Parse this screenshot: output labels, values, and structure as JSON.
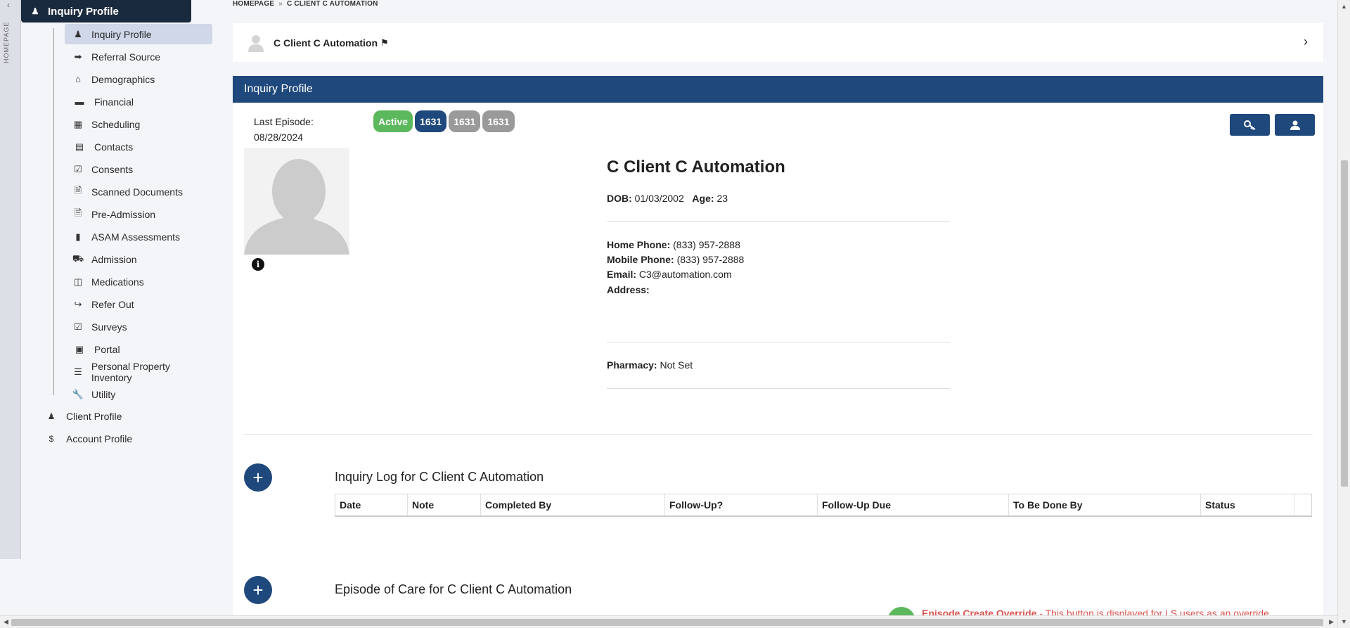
{
  "rail": {
    "vertical_label": "HOMEPAGE"
  },
  "sidebar": {
    "active_label": "Inquiry Profile",
    "subitems": [
      {
        "label": "Inquiry Profile",
        "icon": "user-icon"
      },
      {
        "label": "Referral Source",
        "icon": "sign-in-icon"
      },
      {
        "label": "Demographics",
        "icon": "home-icon"
      },
      {
        "label": "Financial",
        "icon": "credit-card-icon"
      },
      {
        "label": "Scheduling",
        "icon": "calendar-icon"
      },
      {
        "label": "Contacts",
        "icon": "address-card-icon"
      },
      {
        "label": "Consents",
        "icon": "check-square-icon"
      },
      {
        "label": "Scanned Documents",
        "icon": "file-icon"
      },
      {
        "label": "Pre-Admission",
        "icon": "file-icon"
      },
      {
        "label": "ASAM Assessments",
        "icon": "book-icon"
      },
      {
        "label": "Admission",
        "icon": "car-icon"
      },
      {
        "label": "Medications",
        "icon": "medkit-icon"
      },
      {
        "label": "Refer Out",
        "icon": "sign-out-icon"
      },
      {
        "label": "Surveys",
        "icon": "check-square-icon"
      },
      {
        "label": "Portal",
        "icon": "laptop-icon"
      },
      {
        "label": "Personal Property Inventory",
        "icon": "list-icon"
      },
      {
        "label": "Utility",
        "icon": "wrench-icon"
      }
    ],
    "top_items": [
      {
        "label": "Client Profile",
        "icon": "user-icon"
      },
      {
        "label": "Account Profile",
        "icon": "dollar-icon"
      }
    ]
  },
  "breadcrumb": {
    "home": "HOMEPAGE",
    "separator": "»",
    "current": "C CLIENT C AUTOMATION"
  },
  "client_bar": {
    "name": "C Client C Automation"
  },
  "panel": {
    "title": "Inquiry Profile",
    "last_episode_label": "Last Episode:",
    "last_episode_date": "08/28/2024",
    "badges": [
      "Active",
      "1631",
      "1631",
      "1631"
    ],
    "client_name": "C Client C Automation",
    "dob_label": "DOB:",
    "dob": "01/03/2002",
    "age_label": "Age:",
    "age": "23",
    "home_phone_label": "Home Phone:",
    "home_phone": "(833) 957-2888",
    "mobile_phone_label": "Mobile Phone:",
    "mobile_phone": "(833) 957-2888",
    "email_label": "Email:",
    "email": "C3@automation.com",
    "address_label": "Address:",
    "pharmacy_label": "Pharmacy:",
    "pharmacy": "Not Set"
  },
  "inquiry_log": {
    "title": "Inquiry Log for C Client C Automation",
    "columns": [
      "Date",
      "Note",
      "Completed By",
      "Follow-Up?",
      "Follow-Up Due",
      "To Be Done By",
      "Status"
    ]
  },
  "episode_of_care": {
    "title": "Episode of Care for C Client C Automation",
    "override_label": "Episode Create Override",
    "override_text": " - This button is displayed for LS users as an override"
  },
  "colors": {
    "navy": "#1f487c",
    "dark_nav": "#1a2a3e",
    "green": "#5cb85c",
    "danger": "#d9534f"
  }
}
